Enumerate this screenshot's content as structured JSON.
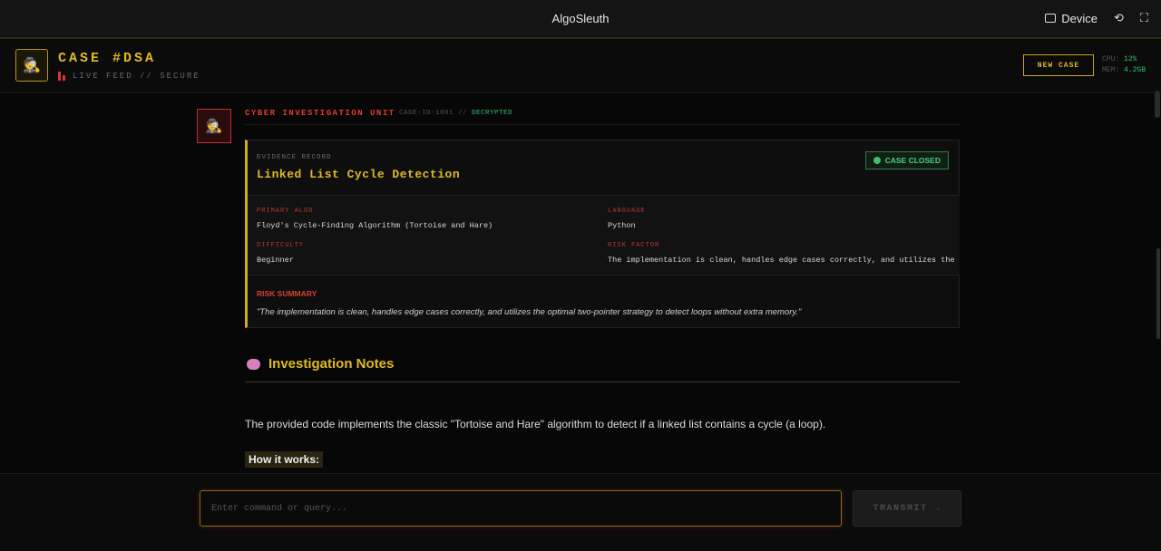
{
  "window": {
    "title": "AlgoSleuth",
    "device_label": "Device"
  },
  "header": {
    "case_title": "CASE #DSA",
    "live_label": "LIVE FEED // SECURE",
    "new_case_label": "NEW CASE",
    "cpu_label": "CPU:",
    "cpu_value": "12%",
    "mem_label": "MEM:",
    "mem_value": "4.2GB"
  },
  "message": {
    "unit": "CYBER INVESTIGATION UNIT",
    "case_id": "CASE-ID-1001 //",
    "status": "DECRYPTED"
  },
  "evidence": {
    "label": "EVIDENCE RECORD",
    "title": "Linked List Cycle Detection",
    "badge": "CASE CLOSED",
    "fields": [
      {
        "key": "PRIMARY ALGO",
        "value": "Floyd's Cycle-Finding Algorithm (Tortoise and Hare)"
      },
      {
        "key": "LANGUAGE",
        "value": "Python"
      },
      {
        "key": "DIFFICULTY",
        "value": "Beginner"
      },
      {
        "key": "RISK FACTOR",
        "value": "The implementation is clean, handles edge cases correctly, and utilizes the optim"
      }
    ],
    "risk_summary_label": "RISK SUMMARY",
    "risk_summary": "\"The implementation is clean, handles edge cases correctly, and utilizes the optimal two-pointer strategy to detect loops without extra memory.\""
  },
  "notes": {
    "heading": "Investigation Notes",
    "paragraph": "The provided code implements the classic \"Tortoise and Hare\" algorithm to detect if a linked list contains a cycle (a loop).",
    "how_heading": "How it works:"
  },
  "input": {
    "placeholder": "Enter command or query...",
    "send_label": "TRANSMIT →"
  },
  "colors": {
    "accent": "#e2b923",
    "danger": "#e03b2f",
    "success": "#38c06e"
  }
}
